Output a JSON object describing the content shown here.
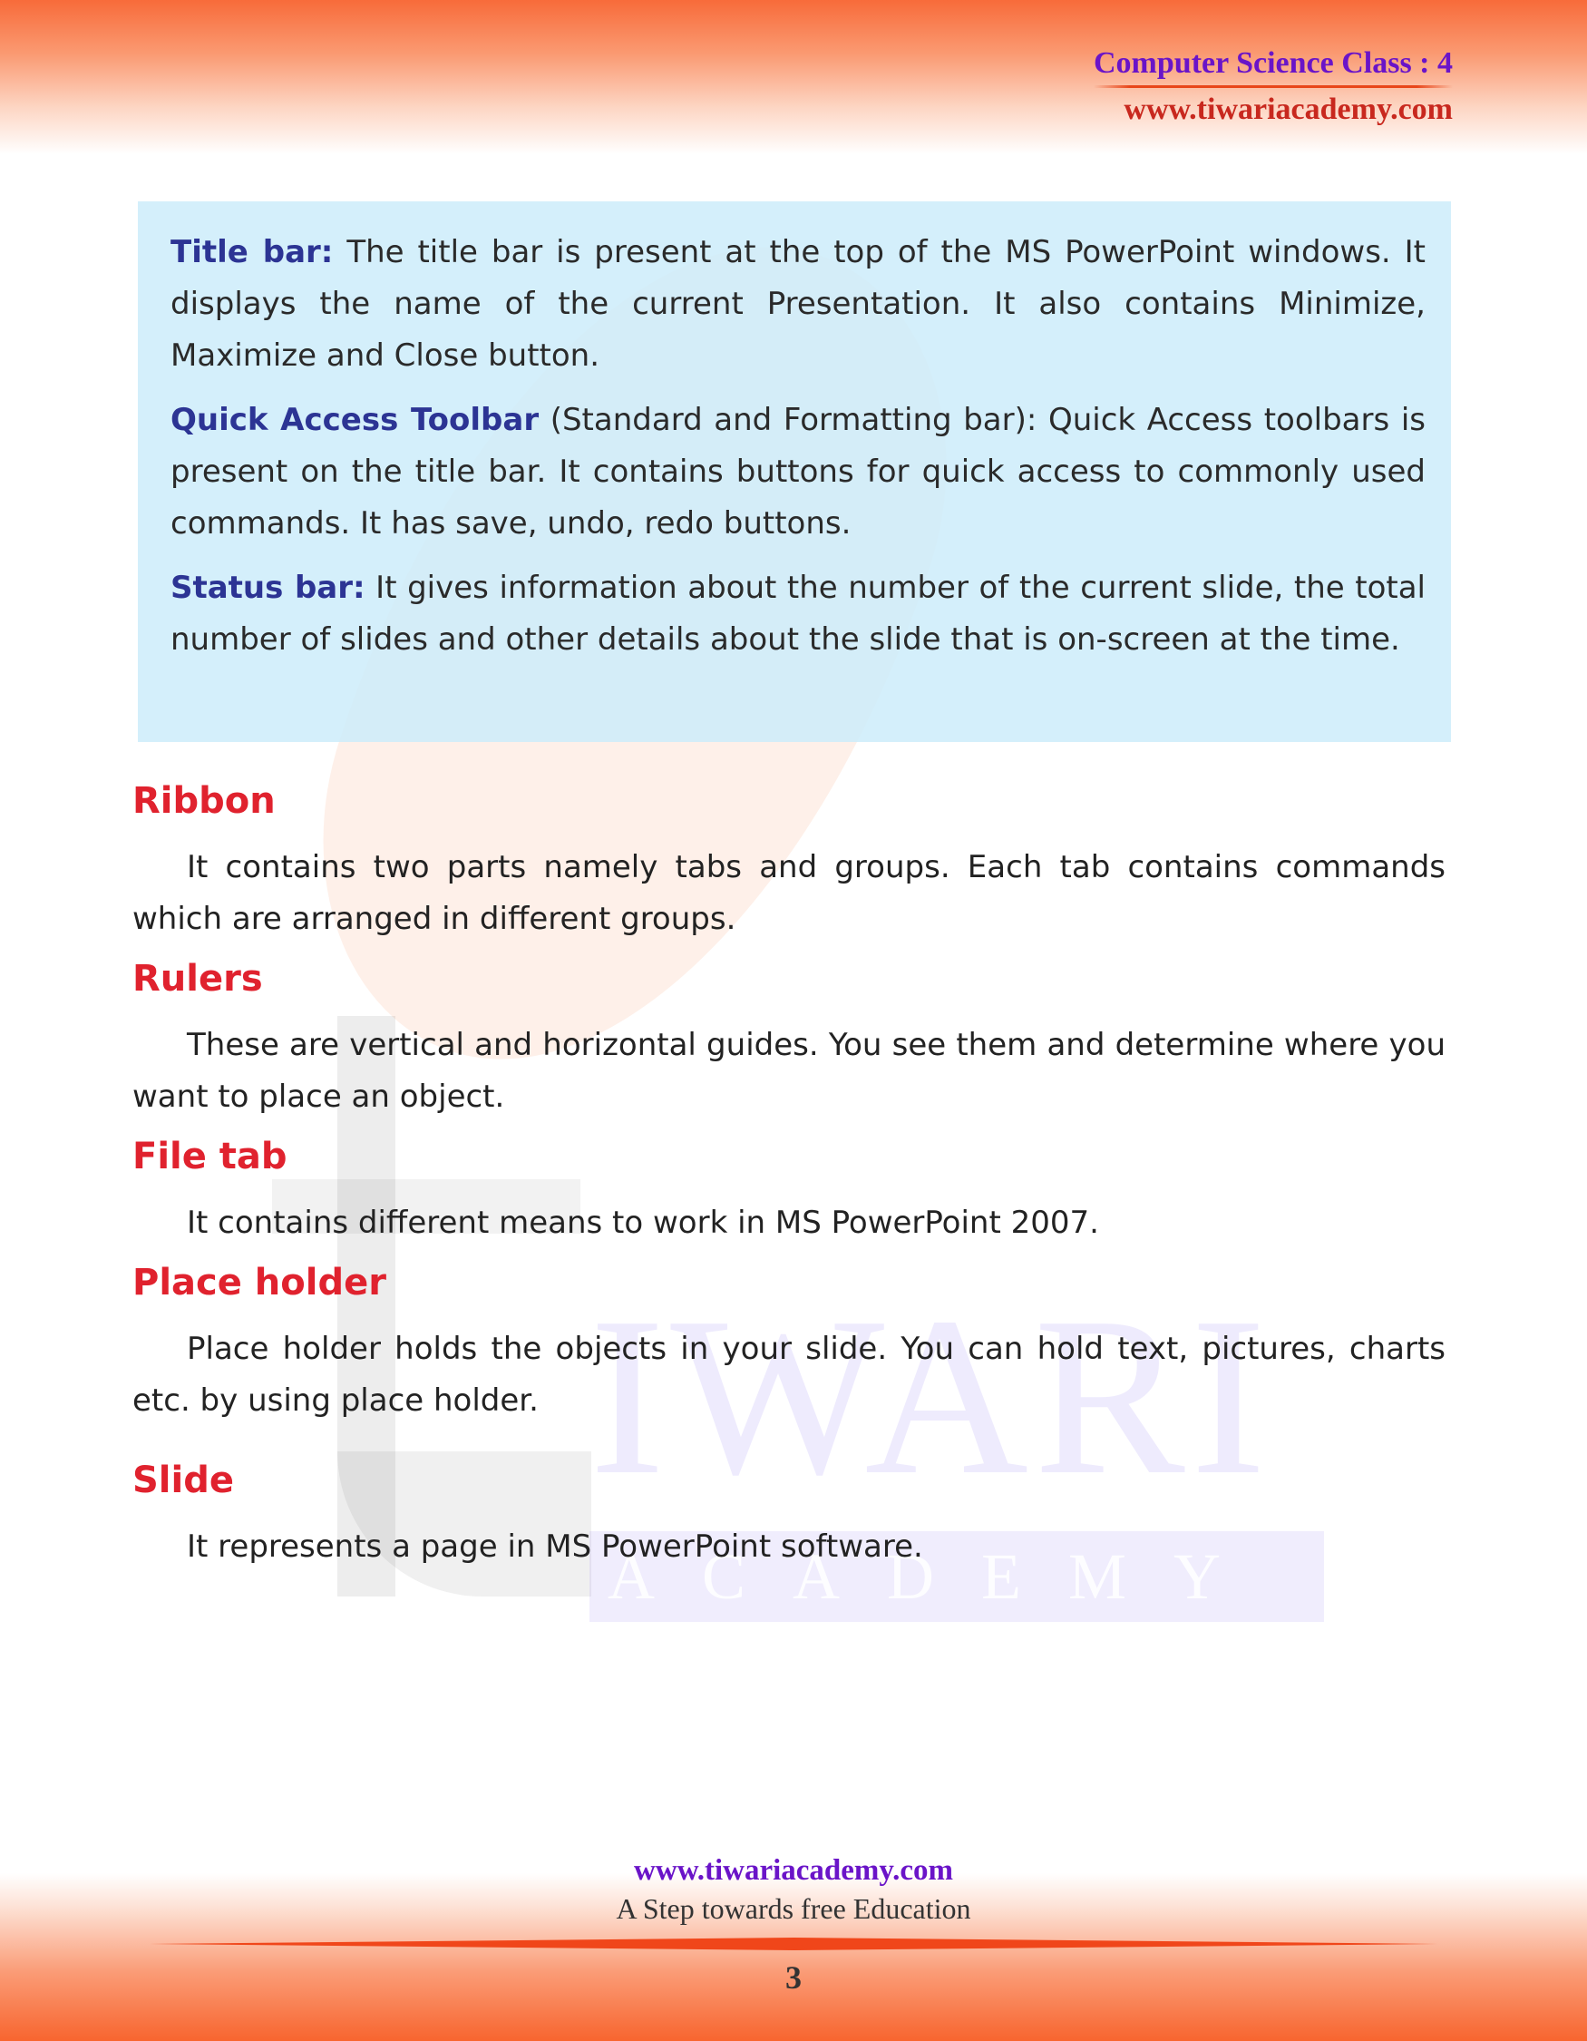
{
  "header": {
    "class_title": "Computer Science Class : 4",
    "site": "www.tiwariacademy.com"
  },
  "watermark": {
    "word1": "IWARI",
    "word2": "ACADEMY"
  },
  "info_box": {
    "items": [
      {
        "term": "Title bar:",
        "text": " The title bar is present at the top of the MS PowerPoint windows. It displays the name of the current Presentation. It also contains Minimize, Maximize and Close button."
      },
      {
        "term": "Quick Access Toolbar",
        "text": " (Standard and Formatting bar): Quick Access toolbars is present on the title bar. It contains buttons for quick access to commonly used commands. It has save, undo, redo buttons."
      },
      {
        "term": "Status bar:",
        "text": " It gives information about the number of the current slide, the total number of slides and other details about the slide that is on-screen at the time."
      }
    ]
  },
  "sections": [
    {
      "heading": "Ribbon",
      "body": "It contains two parts namely tabs and groups. Each tab contains commands which are arranged in different groups."
    },
    {
      "heading": "Rulers",
      "body": "These are vertical and horizontal guides. You see them and determine where you want to place an object."
    },
    {
      "heading": "File tab",
      "body": "It contains different means to work in MS PowerPoint 2007."
    },
    {
      "heading": "Place holder",
      "body": "Place holder holds the objects in your slide. You can hold text, pictures, charts etc. by using place holder."
    },
    {
      "heading": "Slide",
      "body": "It represents a page in MS PowerPoint software."
    }
  ],
  "footer": {
    "site": "www.tiwariacademy.com",
    "tagline": "A Step towards free Education",
    "page_number": "3"
  },
  "colors": {
    "heading_red": "#e0222e",
    "term_blue": "#2c3494",
    "header_purple": "#6a14c8",
    "header_red": "#c8281e",
    "band_orange": "#f86b3a",
    "info_box_bg": "#cdecfa"
  }
}
